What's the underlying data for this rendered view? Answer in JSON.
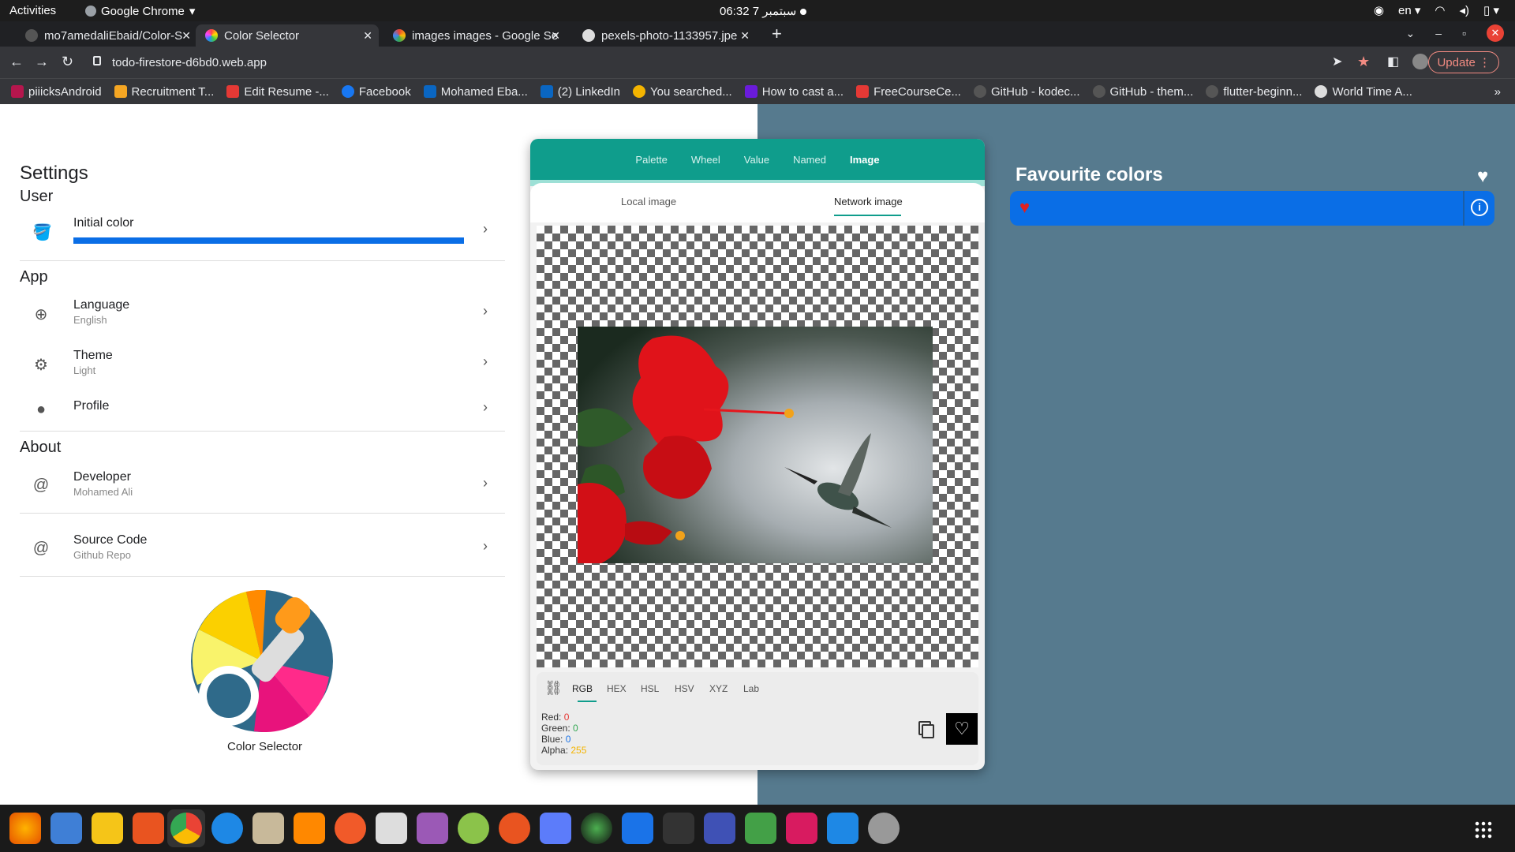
{
  "system_bar": {
    "activities": "Activities",
    "app_name": "Google Chrome",
    "clock": "06:32  7 سبتمبر",
    "language": "en"
  },
  "tabs": [
    {
      "label": "mo7amedaliEbaid/Color-S",
      "active": false
    },
    {
      "label": "Color Selector",
      "active": true
    },
    {
      "label": "images images - Google Se",
      "active": false
    },
    {
      "label": "pexels-photo-1133957.jpe",
      "active": false
    }
  ],
  "address_bar": {
    "url": "todo-firestore-d6bd0.web.app",
    "update_label": "Update"
  },
  "bookmarks": [
    {
      "label": "piiicksAndroid",
      "color": "#b5164d"
    },
    {
      "label": "Recruitment T...",
      "color": "#f5a623"
    },
    {
      "label": "Edit Resume -...",
      "color": "#e53935"
    },
    {
      "label": "Facebook",
      "color": "#1877f2"
    },
    {
      "label": "Mohamed Eba...",
      "color": "#0a66c2"
    },
    {
      "label": "(2) LinkedIn",
      "color": "#0a66c2"
    },
    {
      "label": "You searched...",
      "color": "#f4b400"
    },
    {
      "label": "How to cast a...",
      "color": "#6a1bdb"
    },
    {
      "label": "FreeCourseCe...",
      "color": "#e53935"
    },
    {
      "label": "GitHub - kodec...",
      "color": "#555"
    },
    {
      "label": "GitHub - them...",
      "color": "#555"
    },
    {
      "label": "flutter-beginn...",
      "color": "#555"
    },
    {
      "label": "World Time A...",
      "color": "#ddd"
    }
  ],
  "settings": {
    "title": "Settings",
    "sections": {
      "user": "User",
      "app": "App",
      "about": "About"
    },
    "initial_color": {
      "title": "Initial color",
      "color": "#0a6ee6"
    },
    "language": {
      "title": "Language",
      "subtitle": "English"
    },
    "theme": {
      "title": "Theme",
      "subtitle": "Light"
    },
    "profile": {
      "title": "Profile"
    },
    "developer": {
      "title": "Developer",
      "subtitle": "Mohamed Ali"
    },
    "source_code": {
      "title": "Source Code",
      "subtitle": "Github Repo"
    },
    "logo_caption": "Color Selector"
  },
  "picker": {
    "tabs": [
      "Palette",
      "Wheel",
      "Value",
      "Named",
      "Image"
    ],
    "selected_tab": "Image",
    "subtabs": {
      "local": "Local image",
      "network": "Network image"
    },
    "formats": [
      "RGB",
      "HEX",
      "HSL",
      "HSV",
      "XYZ",
      "Lab"
    ],
    "selected_format": "RGB",
    "values": {
      "red_label": "Red:",
      "red": "0",
      "green_label": "Green:",
      "green": "0",
      "blue_label": "Blue:",
      "blue": "0",
      "alpha_label": "Alpha:",
      "alpha": "255"
    }
  },
  "favourites": {
    "title": "Favourite colors",
    "items": [
      {
        "color": "#0a6ee6"
      }
    ]
  },
  "colors": {
    "accent": "#0f9d8c",
    "right_bg": "#567a8e",
    "selected_color": "#0a6ee6"
  }
}
